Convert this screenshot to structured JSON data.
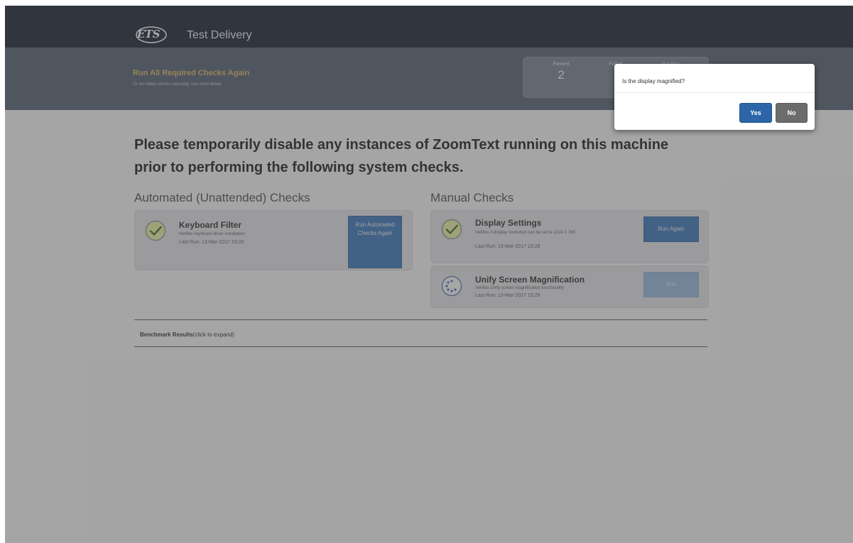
{
  "header": {
    "logo_text": "ETS",
    "app_title": "Test Delivery"
  },
  "subheader": {
    "rerun_label": "Run All Required Checks Again",
    "rerun_sub": "Or run failed checks manually, see icons below",
    "stats": [
      {
        "label": "Passed",
        "value": "2"
      },
      {
        "label": "Failed",
        "value": ""
      },
      {
        "label": "Not Run",
        "value": ""
      }
    ]
  },
  "warning": "Please temporarily disable any instances of ZoomText running on this machine prior to performing the following system checks.",
  "automated": {
    "title": "Automated (Unattended) Checks",
    "card": {
      "title": "Keyboard Filter",
      "desc": "Verifies keyboard driver installation.",
      "last_run": "Last Run: 13-Mar-2017 15:28",
      "button": "Run Automated Checks Again"
    }
  },
  "manual": {
    "title": "Manual Checks",
    "cards": [
      {
        "title": "Display Settings",
        "desc": "Verifies if display resolution can be set to 1024 X 768",
        "last_run": "Last Run: 13-Mar-2017 15:28",
        "button": "Run Again"
      },
      {
        "title": "Unify Screen Magnification",
        "desc": "Verifies Unify screen magnification functionality",
        "last_run": "Last Run: 13-Mar-2017 15:29",
        "button": "Run"
      }
    ]
  },
  "benchmark": {
    "label": "Benchmark Results",
    "hint": "(click to expand)"
  },
  "dialog": {
    "message": "Is the display magnified?",
    "yes_label": "Yes",
    "no_label": "No"
  }
}
